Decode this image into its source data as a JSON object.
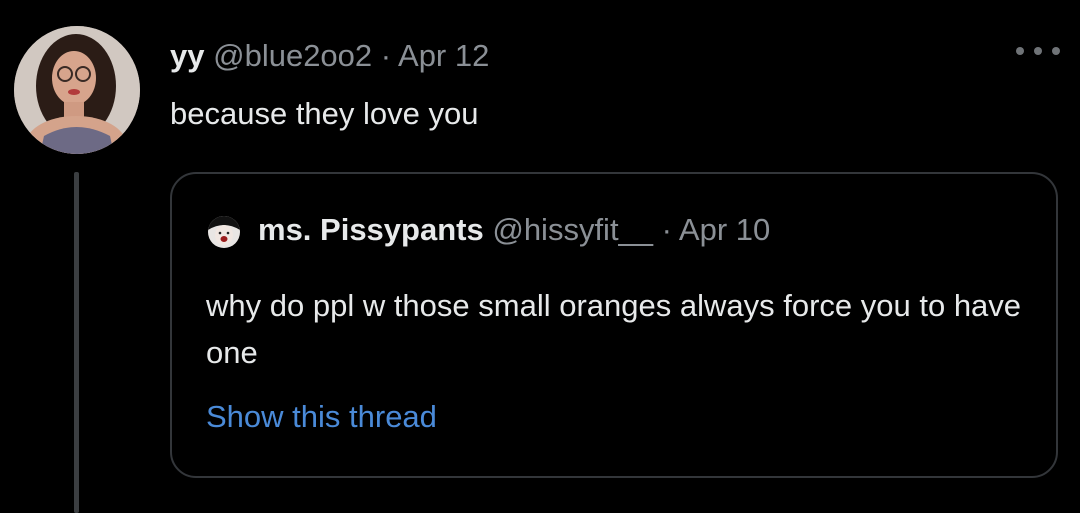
{
  "tweet": {
    "display_name": "yy",
    "handle": "@blue2oo2",
    "separator": "·",
    "date": "Apr 12",
    "text": "because they love you",
    "avatar_icon": "profile-photo",
    "more_icon": "ellipsis-icon"
  },
  "quote": {
    "display_name": "ms. Pissypants",
    "handle": "@hissyfit__",
    "separator": "·",
    "date": "Apr 10",
    "text": "why do ppl w those small oranges always force you to have one",
    "link_label": "Show this thread",
    "avatar_icon": "profile-photo"
  },
  "colors": {
    "background": "#000000",
    "primary_text": "#e7e9ea",
    "secondary_text": "#8b9096",
    "link": "#4a8ad8",
    "border": "#33363a"
  }
}
